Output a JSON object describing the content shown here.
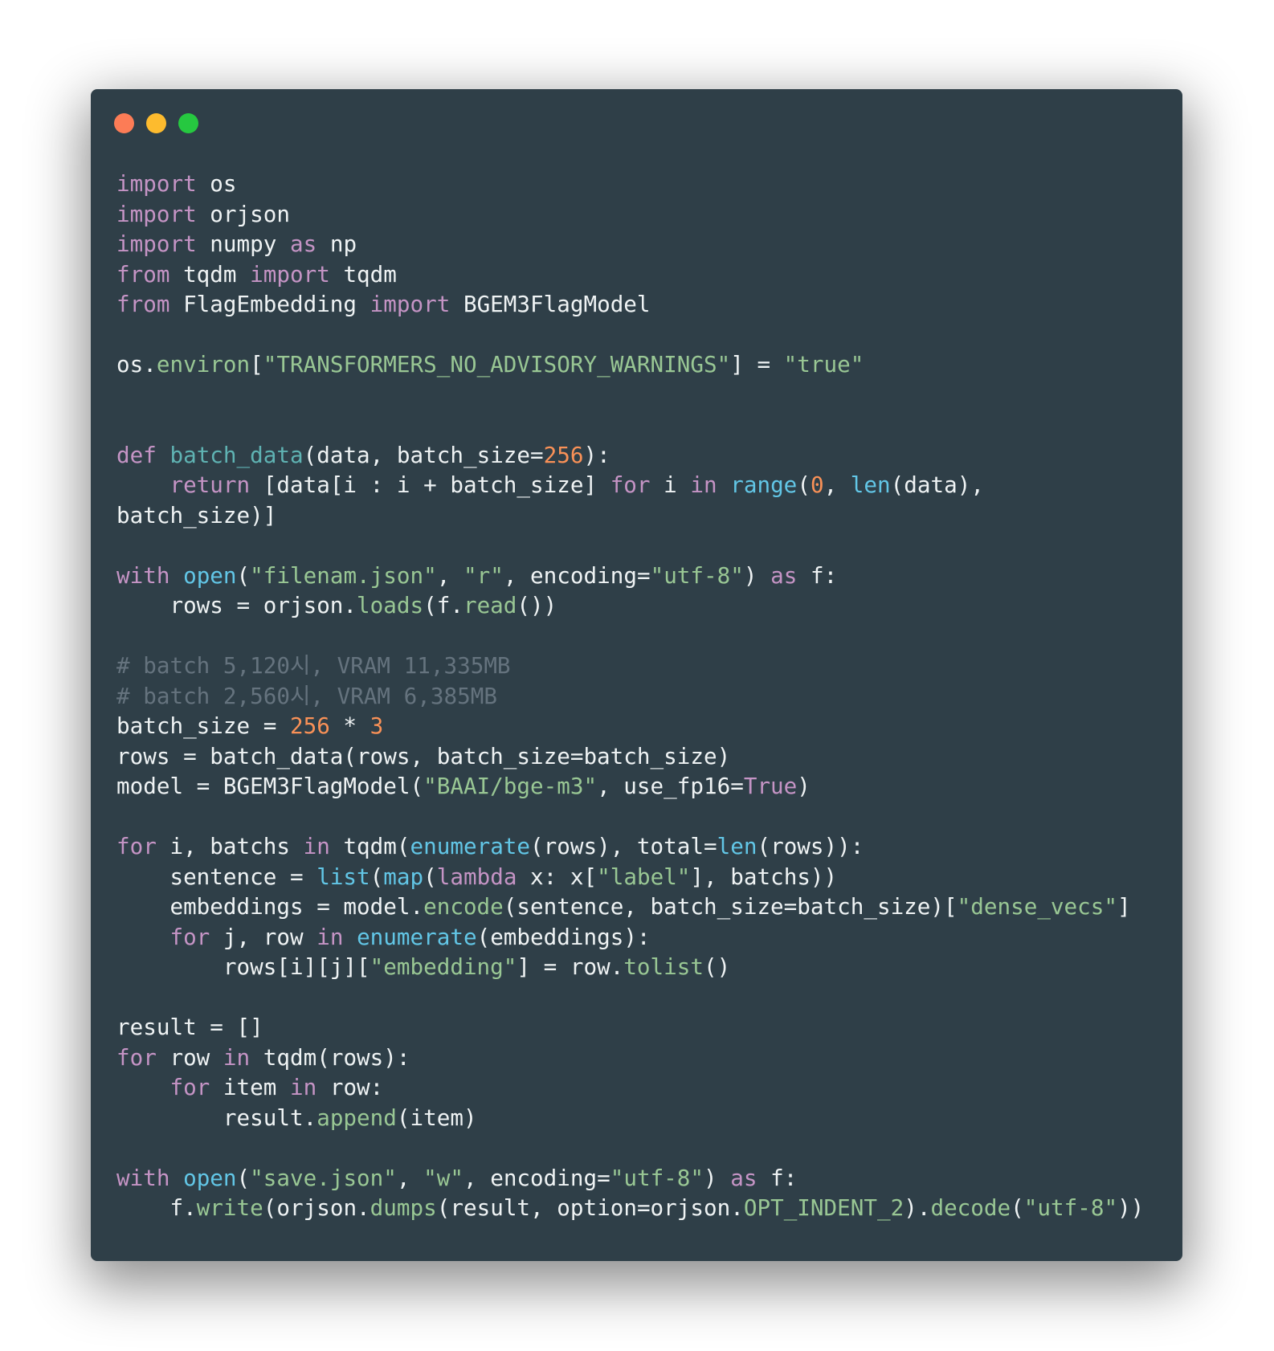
{
  "window": {
    "controls": [
      {
        "name": "close",
        "color": "#fc7c56"
      },
      {
        "name": "minimize",
        "color": "#fdbb2e"
      },
      {
        "name": "maximize",
        "color": "#26c840"
      }
    ]
  },
  "code": {
    "language": "python",
    "lines": [
      [
        [
          "kw",
          "import"
        ],
        [
          "t",
          " os"
        ]
      ],
      [
        [
          "kw",
          "import"
        ],
        [
          "t",
          " orjson"
        ]
      ],
      [
        [
          "kw",
          "import"
        ],
        [
          "t",
          " numpy "
        ],
        [
          "kw",
          "as"
        ],
        [
          "t",
          " np"
        ]
      ],
      [
        [
          "kw",
          "from"
        ],
        [
          "t",
          " tqdm "
        ],
        [
          "kw",
          "import"
        ],
        [
          "t",
          " tqdm"
        ]
      ],
      [
        [
          "kw",
          "from"
        ],
        [
          "t",
          " FlagEmbedding "
        ],
        [
          "kw",
          "import"
        ],
        [
          "t",
          " BGEM3FlagModel"
        ]
      ],
      [],
      [
        [
          "t",
          "os."
        ],
        [
          "meth",
          "environ"
        ],
        [
          "t",
          "["
        ],
        [
          "str",
          "\"TRANSFORMERS_NO_ADVISORY_WARNINGS\""
        ],
        [
          "t",
          "] = "
        ],
        [
          "str",
          "\"true\""
        ]
      ],
      [],
      [],
      [
        [
          "kw",
          "def"
        ],
        [
          "t",
          " "
        ],
        [
          "fn",
          "batch_data"
        ],
        [
          "t",
          "(data, batch_size="
        ],
        [
          "num",
          "256"
        ],
        [
          "t",
          "):"
        ]
      ],
      [
        [
          "t",
          "    "
        ],
        [
          "kw",
          "return"
        ],
        [
          "t",
          " [data[i : i + batch_size] "
        ],
        [
          "kw",
          "for"
        ],
        [
          "t",
          " i "
        ],
        [
          "kw",
          "in"
        ],
        [
          "t",
          " "
        ],
        [
          "bi",
          "range"
        ],
        [
          "t",
          "("
        ],
        [
          "num",
          "0"
        ],
        [
          "t",
          ", "
        ],
        [
          "bi",
          "len"
        ],
        [
          "t",
          "(data),"
        ]
      ],
      [
        [
          "t",
          "batch_size)]"
        ]
      ],
      [],
      [
        [
          "kw",
          "with"
        ],
        [
          "t",
          " "
        ],
        [
          "bi",
          "open"
        ],
        [
          "t",
          "("
        ],
        [
          "str",
          "\"filenam.json\""
        ],
        [
          "t",
          ", "
        ],
        [
          "str",
          "\"r\""
        ],
        [
          "t",
          ", encoding="
        ],
        [
          "str",
          "\"utf-8\""
        ],
        [
          "t",
          ") "
        ],
        [
          "kw",
          "as"
        ],
        [
          "t",
          " f:"
        ]
      ],
      [
        [
          "t",
          "    rows = orjson."
        ],
        [
          "meth",
          "loads"
        ],
        [
          "t",
          "(f."
        ],
        [
          "meth",
          "read"
        ],
        [
          "t",
          "())"
        ]
      ],
      [],
      [
        [
          "cm",
          "# batch 5,120시, VRAM 11,335MB"
        ]
      ],
      [
        [
          "cm",
          "# batch 2,560시, VRAM 6,385MB"
        ]
      ],
      [
        [
          "t",
          "batch_size = "
        ],
        [
          "num",
          "256"
        ],
        [
          "t",
          " * "
        ],
        [
          "num",
          "3"
        ]
      ],
      [
        [
          "t",
          "rows = batch_data(rows, batch_size=batch_size)"
        ]
      ],
      [
        [
          "t",
          "model = BGEM3FlagModel("
        ],
        [
          "str",
          "\"BAAI/bge-m3\""
        ],
        [
          "t",
          ", use_fp16="
        ],
        [
          "kw",
          "True"
        ],
        [
          "t",
          ")"
        ]
      ],
      [],
      [
        [
          "kw",
          "for"
        ],
        [
          "t",
          " i, batchs "
        ],
        [
          "kw",
          "in"
        ],
        [
          "t",
          " tqdm("
        ],
        [
          "bi",
          "enumerate"
        ],
        [
          "t",
          "(rows), total="
        ],
        [
          "bi",
          "len"
        ],
        [
          "t",
          "(rows)):"
        ]
      ],
      [
        [
          "t",
          "    sentence = "
        ],
        [
          "bi",
          "list"
        ],
        [
          "t",
          "("
        ],
        [
          "bi",
          "map"
        ],
        [
          "t",
          "("
        ],
        [
          "kw",
          "lambda"
        ],
        [
          "t",
          " x: x["
        ],
        [
          "str",
          "\"label\""
        ],
        [
          "t",
          "], batchs))"
        ]
      ],
      [
        [
          "t",
          "    embeddings = model."
        ],
        [
          "meth",
          "encode"
        ],
        [
          "t",
          "(sentence, batch_size=batch_size)["
        ],
        [
          "str",
          "\"dense_vecs\""
        ],
        [
          "t",
          "]"
        ]
      ],
      [
        [
          "t",
          "    "
        ],
        [
          "kw",
          "for"
        ],
        [
          "t",
          " j, row "
        ],
        [
          "kw",
          "in"
        ],
        [
          "t",
          " "
        ],
        [
          "bi",
          "enumerate"
        ],
        [
          "t",
          "(embeddings):"
        ]
      ],
      [
        [
          "t",
          "        rows[i][j]["
        ],
        [
          "str",
          "\"embedding\""
        ],
        [
          "t",
          "] = row."
        ],
        [
          "meth",
          "tolist"
        ],
        [
          "t",
          "()"
        ]
      ],
      [],
      [
        [
          "t",
          "result = []"
        ]
      ],
      [
        [
          "kw",
          "for"
        ],
        [
          "t",
          " row "
        ],
        [
          "kw",
          "in"
        ],
        [
          "t",
          " tqdm(rows):"
        ]
      ],
      [
        [
          "t",
          "    "
        ],
        [
          "kw",
          "for"
        ],
        [
          "t",
          " item "
        ],
        [
          "kw",
          "in"
        ],
        [
          "t",
          " row:"
        ]
      ],
      [
        [
          "t",
          "        result."
        ],
        [
          "meth",
          "append"
        ],
        [
          "t",
          "(item)"
        ]
      ],
      [],
      [
        [
          "kw",
          "with"
        ],
        [
          "t",
          " "
        ],
        [
          "bi",
          "open"
        ],
        [
          "t",
          "("
        ],
        [
          "str",
          "\"save.json\""
        ],
        [
          "t",
          ", "
        ],
        [
          "str",
          "\"w\""
        ],
        [
          "t",
          ", encoding="
        ],
        [
          "str",
          "\"utf-8\""
        ],
        [
          "t",
          ") "
        ],
        [
          "kw",
          "as"
        ],
        [
          "t",
          " f:"
        ]
      ],
      [
        [
          "t",
          "    f."
        ],
        [
          "meth",
          "write"
        ],
        [
          "t",
          "(orjson."
        ],
        [
          "meth",
          "dumps"
        ],
        [
          "t",
          "(result, option=orjson."
        ],
        [
          "meth",
          "OPT_INDENT_2"
        ],
        [
          "t",
          ")."
        ],
        [
          "meth",
          "decode"
        ],
        [
          "t",
          "("
        ],
        [
          "str",
          "\"utf-8\""
        ],
        [
          "t",
          "))"
        ]
      ]
    ]
  },
  "syntax_colors": {
    "background": "#2f3f48",
    "text": "#eff3f4",
    "keyword": "#c594c5",
    "function_def": "#5fb3b3",
    "builtin": "#62c6e6",
    "string": "#99c794",
    "number": "#f99157",
    "comment": "#65737e"
  }
}
